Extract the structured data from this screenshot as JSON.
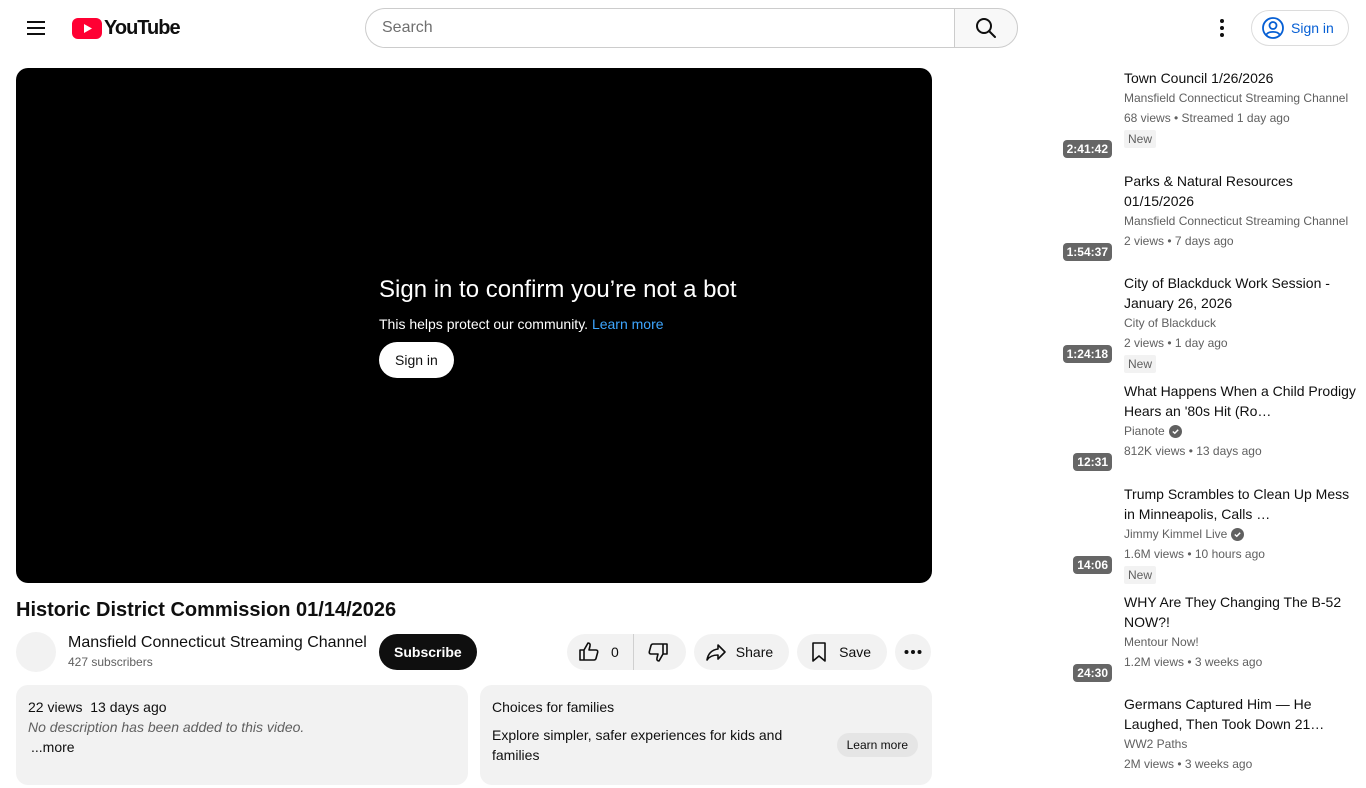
{
  "header": {
    "logo_text": "YouTube",
    "search_placeholder": "Search",
    "signin_label": "Sign in"
  },
  "player": {
    "bot_title": "Sign in to confirm you’re not a bot",
    "bot_subtitle": "This helps protect our community.",
    "learn_more": "Learn more",
    "signin_button": "Sign in"
  },
  "video": {
    "title": "Historic District Commission 01/14/2026",
    "channel_name": "Mansfield Connecticut Streaming Channel",
    "subscribers": "427 subscribers",
    "subscribe_label": "Subscribe",
    "like_count": "0",
    "share_label": "Share",
    "save_label": "Save"
  },
  "description": {
    "views": "22 views",
    "date": "13 days ago",
    "empty_text": "No description has been added to this video.",
    "more_label": "...more"
  },
  "families": {
    "title": "Choices for families",
    "text": "Explore simpler, safer experiences for kids and families",
    "learn_more": "Learn more"
  },
  "recommendations": [
    {
      "title": "Town Council   1/26/2026",
      "channel": "Mansfield Connecticut Streaming Channel",
      "meta": "68 views • Streamed 1 day ago",
      "badge": "New",
      "duration": "2:41:42",
      "verified": false
    },
    {
      "title": "Parks & Natural Resources 01/15/2026",
      "channel": "Mansfield Connecticut Streaming Channel",
      "meta": "2 views • 7 days ago",
      "badge": "",
      "duration": "1:54:37",
      "verified": false
    },
    {
      "title": "City of Blackduck Work Session - January 26, 2026",
      "channel": "City of Blackduck",
      "meta": "2 views • 1 day ago",
      "badge": "New",
      "duration": "1:24:18",
      "verified": false
    },
    {
      "title": "What Happens When a Child Prodigy Hears an '80s Hit (Ro…",
      "channel": "Pianote",
      "meta": "812K views • 13 days ago",
      "badge": "",
      "duration": "12:31",
      "verified": true
    },
    {
      "title": "Trump Scrambles to Clean Up Mess in Minneapolis, Calls …",
      "channel": "Jimmy Kimmel Live",
      "meta": "1.6M views • 10 hours ago",
      "badge": "New",
      "duration": "14:06",
      "verified": true
    },
    {
      "title": "WHY Are They Changing The B-52 NOW?!",
      "channel": "Mentour Now!",
      "meta": "1.2M views • 3 weeks ago",
      "badge": "",
      "duration": "24:30",
      "verified": false
    },
    {
      "title": "Germans Captured Him — He Laughed, Then Took Down 21…",
      "channel": "WW2 Paths",
      "meta": "2M views • 3 weeks ago",
      "badge": "",
      "duration": "",
      "verified": false
    }
  ]
}
